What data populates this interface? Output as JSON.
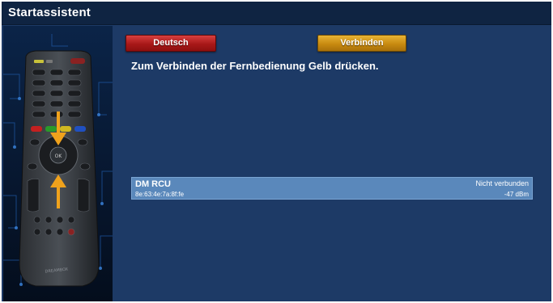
{
  "header": {
    "title": "Startassistent"
  },
  "buttons": {
    "red_label": "Deutsch",
    "yellow_label": "Verbinden"
  },
  "instruction": "Zum Verbinden der Fernbedienung Gelb drücken.",
  "devices": [
    {
      "name": "DM RCU",
      "status": "Nicht verbunden",
      "mac": "8e:63:4e:7a:8f:fe",
      "signal": "-47 dBm"
    }
  ],
  "remote": {
    "brand_text": "DREAMBOX"
  },
  "colors": {
    "background": "#1d3a66",
    "titlebar": "#0f2442",
    "red_button": "#c02828",
    "yellow_button": "#d49a1c",
    "selection": "#5a88bb",
    "arrow": "#f0a21c"
  }
}
